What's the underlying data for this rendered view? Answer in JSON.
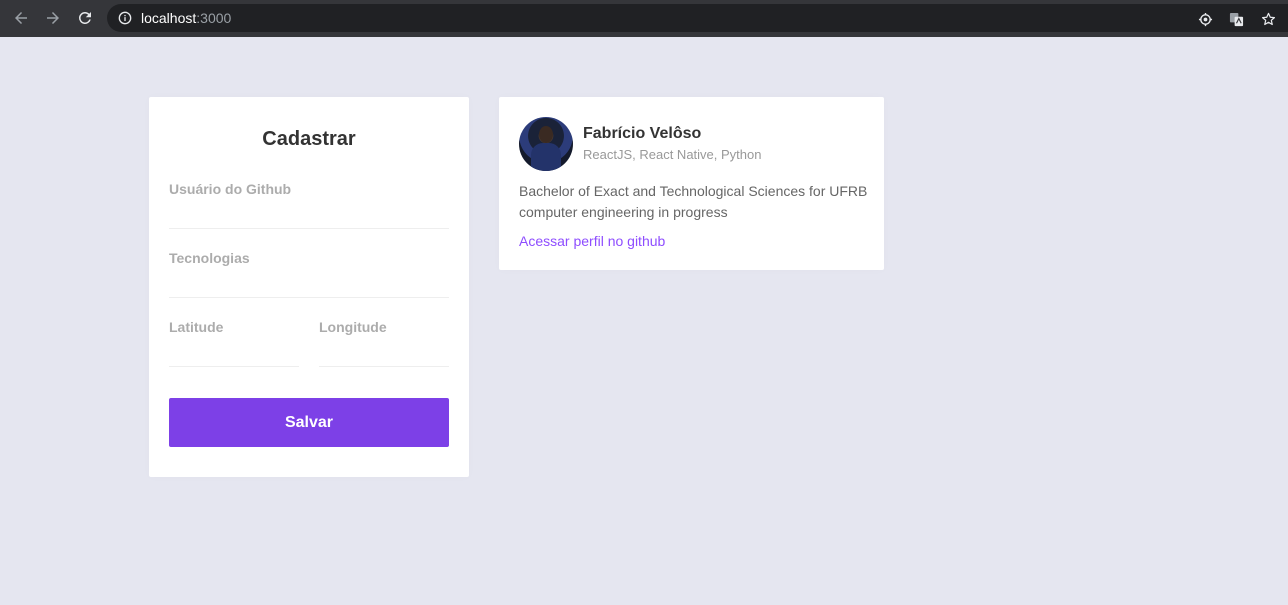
{
  "browser": {
    "url_host": "localhost",
    "url_port": ":3000",
    "icons": [
      "back-arrow-icon",
      "forward-arrow-icon",
      "reload-icon",
      "info-icon",
      "location-icon",
      "translate-icon",
      "star-icon"
    ]
  },
  "form": {
    "title": "Cadastrar",
    "fields": {
      "github_user": {
        "label": "Usuário do Github",
        "value": ""
      },
      "techs": {
        "label": "Tecnologias",
        "value": ""
      },
      "latitude": {
        "label": "Latitude",
        "value": ""
      },
      "longitude": {
        "label": "Longitude",
        "value": ""
      }
    },
    "submit_label": "Salvar"
  },
  "dev": {
    "name": "Fabrício Velôso",
    "techs": "ReactJS, React Native, Python",
    "bio": "Bachelor of Exact and Technological Sciences for UFRB computer engineering in progress",
    "link_label": "Acessar perfil no github"
  },
  "colors": {
    "page_bg": "#e5e6f0",
    "accent": "#7d40e7",
    "link": "#8e4dff"
  }
}
